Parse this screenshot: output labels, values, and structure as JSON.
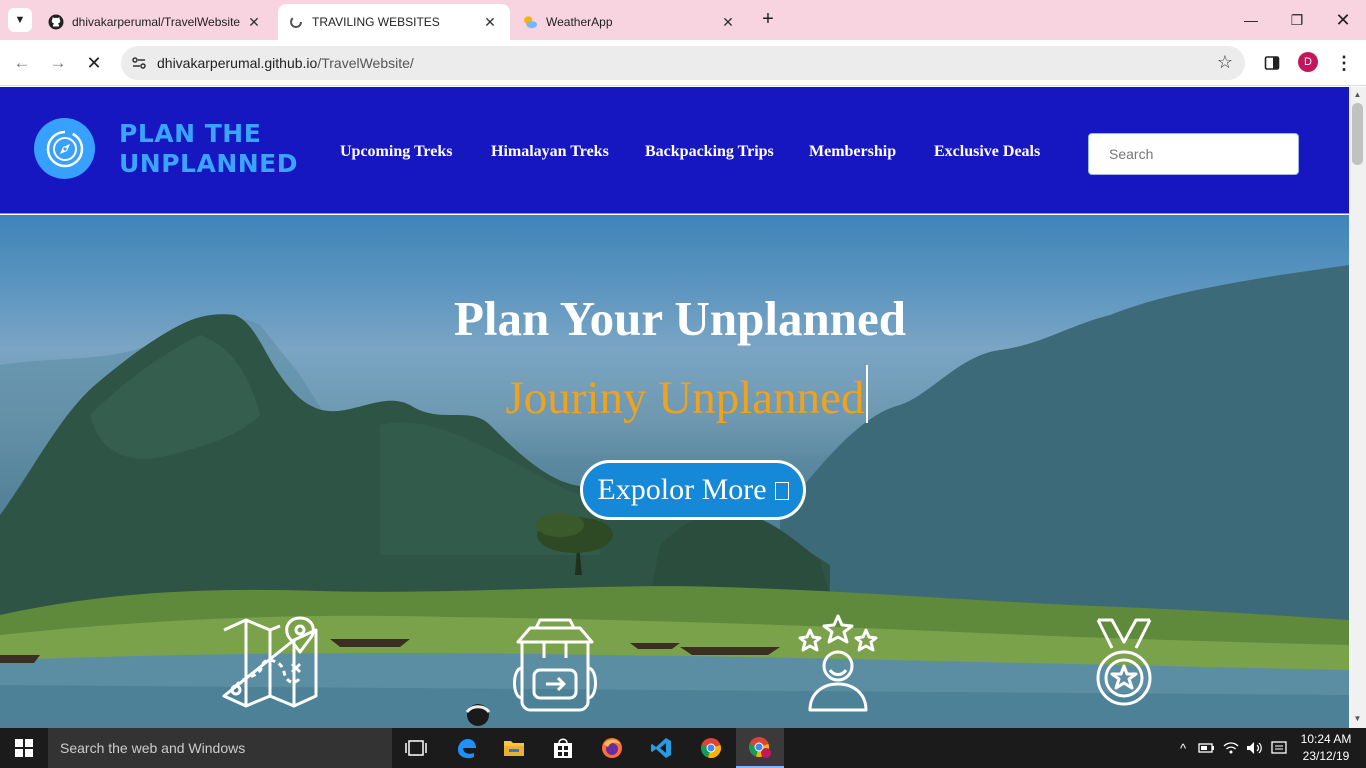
{
  "browser": {
    "tabs": [
      {
        "title": "dhivakarperumal/TravelWebsite",
        "icon": "github-icon",
        "active": false
      },
      {
        "title": "TRAVILING WEBSITES",
        "icon": "loading-icon",
        "active": true
      },
      {
        "title": "WeatherApp",
        "icon": "weather-icon",
        "active": false
      }
    ],
    "close_glyph": "✕",
    "new_tab_glyph": "+",
    "address": {
      "host": "dhivakarperumal.github.io",
      "path": "/TravelWebsite/"
    },
    "profile_initial": "D"
  },
  "site": {
    "logo_line1": "PLAN THE",
    "logo_line2": "UNPLANNED",
    "nav": [
      "Upcoming Treks",
      "Himalayan Treks",
      "Backpacking Trips",
      "Membership",
      "Exclusive Deals"
    ],
    "search_placeholder": "Search",
    "hero_title": "Plan Your Unplanned",
    "hero_subtitle": "Jouriny Unplanned",
    "cta_label": "Expolor More",
    "feature_icons": [
      "map-icon",
      "backpack-icon",
      "rated-person-icon",
      "medal-icon"
    ]
  },
  "taskbar": {
    "search_placeholder": "Search the web and Windows",
    "apps": [
      "task-view-icon",
      "edge-icon",
      "file-explorer-icon",
      "store-icon",
      "firefox-icon",
      "vscode-icon",
      "chrome-icon",
      "chrome-profile-icon"
    ],
    "time": "10:24 AM",
    "date": "23/12/19"
  },
  "colors": {
    "tabbar": "#f7d4e0",
    "site_header": "#1717c2",
    "logo_blue": "#3aa4ff",
    "subtitle_orange": "#f0a21a",
    "cta_blue": "#1688d8"
  }
}
